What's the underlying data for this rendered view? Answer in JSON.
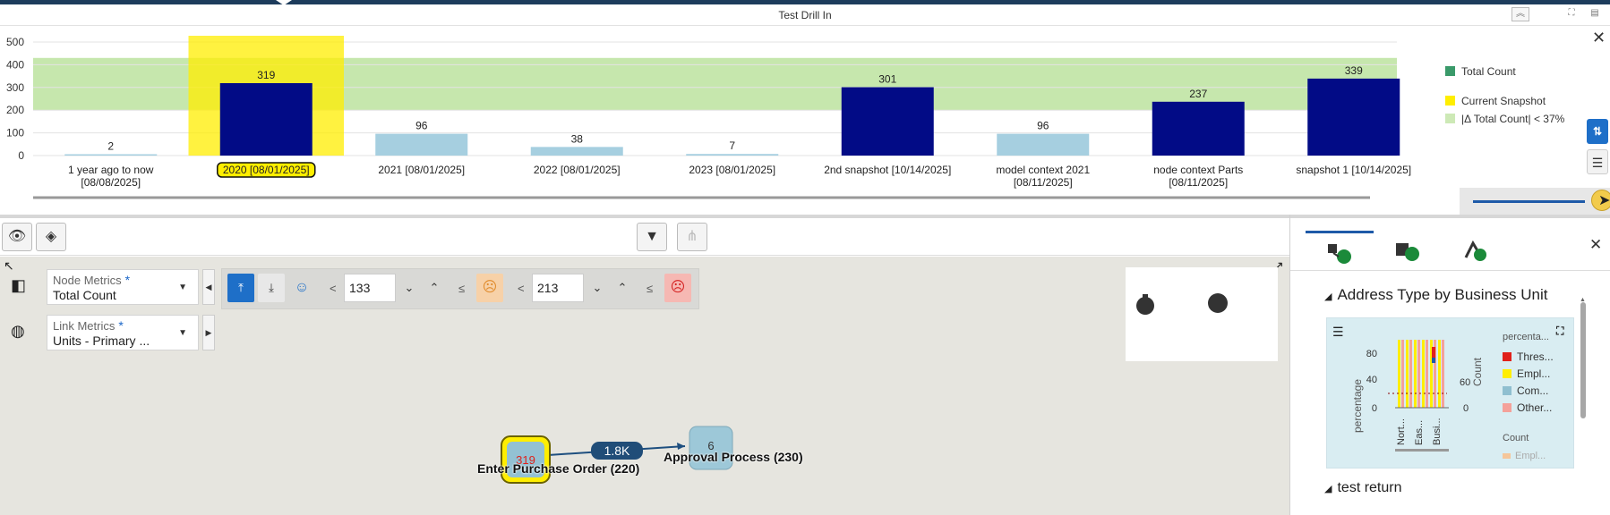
{
  "window": {
    "title": "Test Drill In"
  },
  "chart_data": {
    "type": "bar",
    "categories": [
      "1 year ago to now [08/08/2025]",
      "2020 [08/01/2025]",
      "2021 [08/01/2025]",
      "2022 [08/01/2025]",
      "2023 [08/01/2025]",
      "2nd snapshot [10/14/2025]",
      "model context 2021 [08/11/2025]",
      "node context Parts [08/11/2025]",
      "snapshot 1 [10/14/2025]"
    ],
    "category_lines": [
      [
        "1 year ago to now",
        "[08/08/2025]"
      ],
      [
        "2020 [08/01/2025]"
      ],
      [
        "2021 [08/01/2025]"
      ],
      [
        "2022 [08/01/2025]"
      ],
      [
        "2023 [08/01/2025]"
      ],
      [
        "2nd snapshot [10/14/2025]"
      ],
      [
        "model context 2021",
        "[08/11/2025]"
      ],
      [
        "node context Parts",
        "[08/11/2025]"
      ],
      [
        "snapshot 1 [10/14/2025]"
      ]
    ],
    "series": [
      {
        "name": "Total Count",
        "values": [
          2,
          319,
          96,
          38,
          7,
          301,
          96,
          237,
          339
        ]
      }
    ],
    "bar_emphasis": [
      "light",
      "dark",
      "light",
      "light",
      "light",
      "dark",
      "light",
      "dark",
      "dark"
    ],
    "current_snapshot_index": 1,
    "band": {
      "label": "|Δ Total Count| < 37%",
      "from": 200,
      "to": 430
    },
    "ylim": [
      0,
      500
    ],
    "yticks": [
      0,
      100,
      200,
      300,
      400,
      500
    ],
    "legend": [
      {
        "label": "Total Count",
        "color": "#3a9a6a"
      },
      {
        "label": "Current Snapshot",
        "color": "#ffee00"
      },
      {
        "label": "|Δ Total Count| < 37%",
        "color": "#cde9b6"
      }
    ],
    "colors": {
      "dark": "#020b86",
      "light": "#a6cfe0",
      "snapshot": "#ffee00",
      "band": "#c6e7ad"
    }
  },
  "controls": {
    "node_metrics": {
      "label": "Node Metrics",
      "required": "*",
      "value": "Total Count"
    },
    "link_metrics": {
      "label": "Link Metrics",
      "required": "*",
      "value": "Units - Primary ..."
    },
    "threshold": {
      "low_value": "133",
      "high_value": "213",
      "lt": "<",
      "le": "≤"
    }
  },
  "graph": {
    "nodes": [
      {
        "value": "319",
        "label": "Enter Purchase Order (220)"
      },
      {
        "value": "6",
        "label": "Approval Process (230)"
      }
    ],
    "edge_label": "1.8K"
  },
  "panel": {
    "section1": "Address Type by Business Unit",
    "section2": "test return",
    "mini_chart": {
      "ylabel": "percentage",
      "ylabel2": "Count",
      "yticks": [
        "80",
        "40",
        "0"
      ],
      "yticks2": [
        "60",
        "0"
      ],
      "xcats": [
        "Nort...",
        "Eas...",
        "Busi..."
      ],
      "legend_title": "percenta...",
      "legend": [
        {
          "label": "Thres...",
          "color": "#e0211b"
        },
        {
          "label": "Empl...",
          "color": "#ffee00"
        },
        {
          "label": "Com...",
          "color": "#8fbfd0"
        },
        {
          "label": "Other...",
          "color": "#f4a19a"
        }
      ],
      "legend2_title": "Count",
      "legend2_item": "Empl..."
    }
  },
  "icons": [
    "eye-icon",
    "layers-icon",
    "filter-icon",
    "hierarchy-icon",
    "expand-icon",
    "close-icon",
    "menu-icon",
    "fullscreen-icon",
    "cursor-icon"
  ]
}
